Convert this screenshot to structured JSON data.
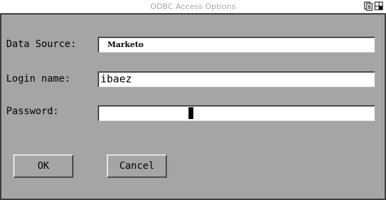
{
  "window": {
    "title": "ODBC Access Options",
    "icons": [
      "restore-icon",
      "maximize-icon"
    ]
  },
  "form": {
    "data_source_label": "Data Source:",
    "data_source_value": "Marketo",
    "login_label": "Login name:",
    "login_value": "ibaez",
    "password_label": "Password:",
    "password_value": ""
  },
  "buttons": {
    "ok_label": "OK",
    "cancel_label": "Cancel"
  },
  "colors": {
    "dialog_background": "#a5a5a5",
    "title_text": "#a7a7a7",
    "field_background": "#ffffff"
  }
}
